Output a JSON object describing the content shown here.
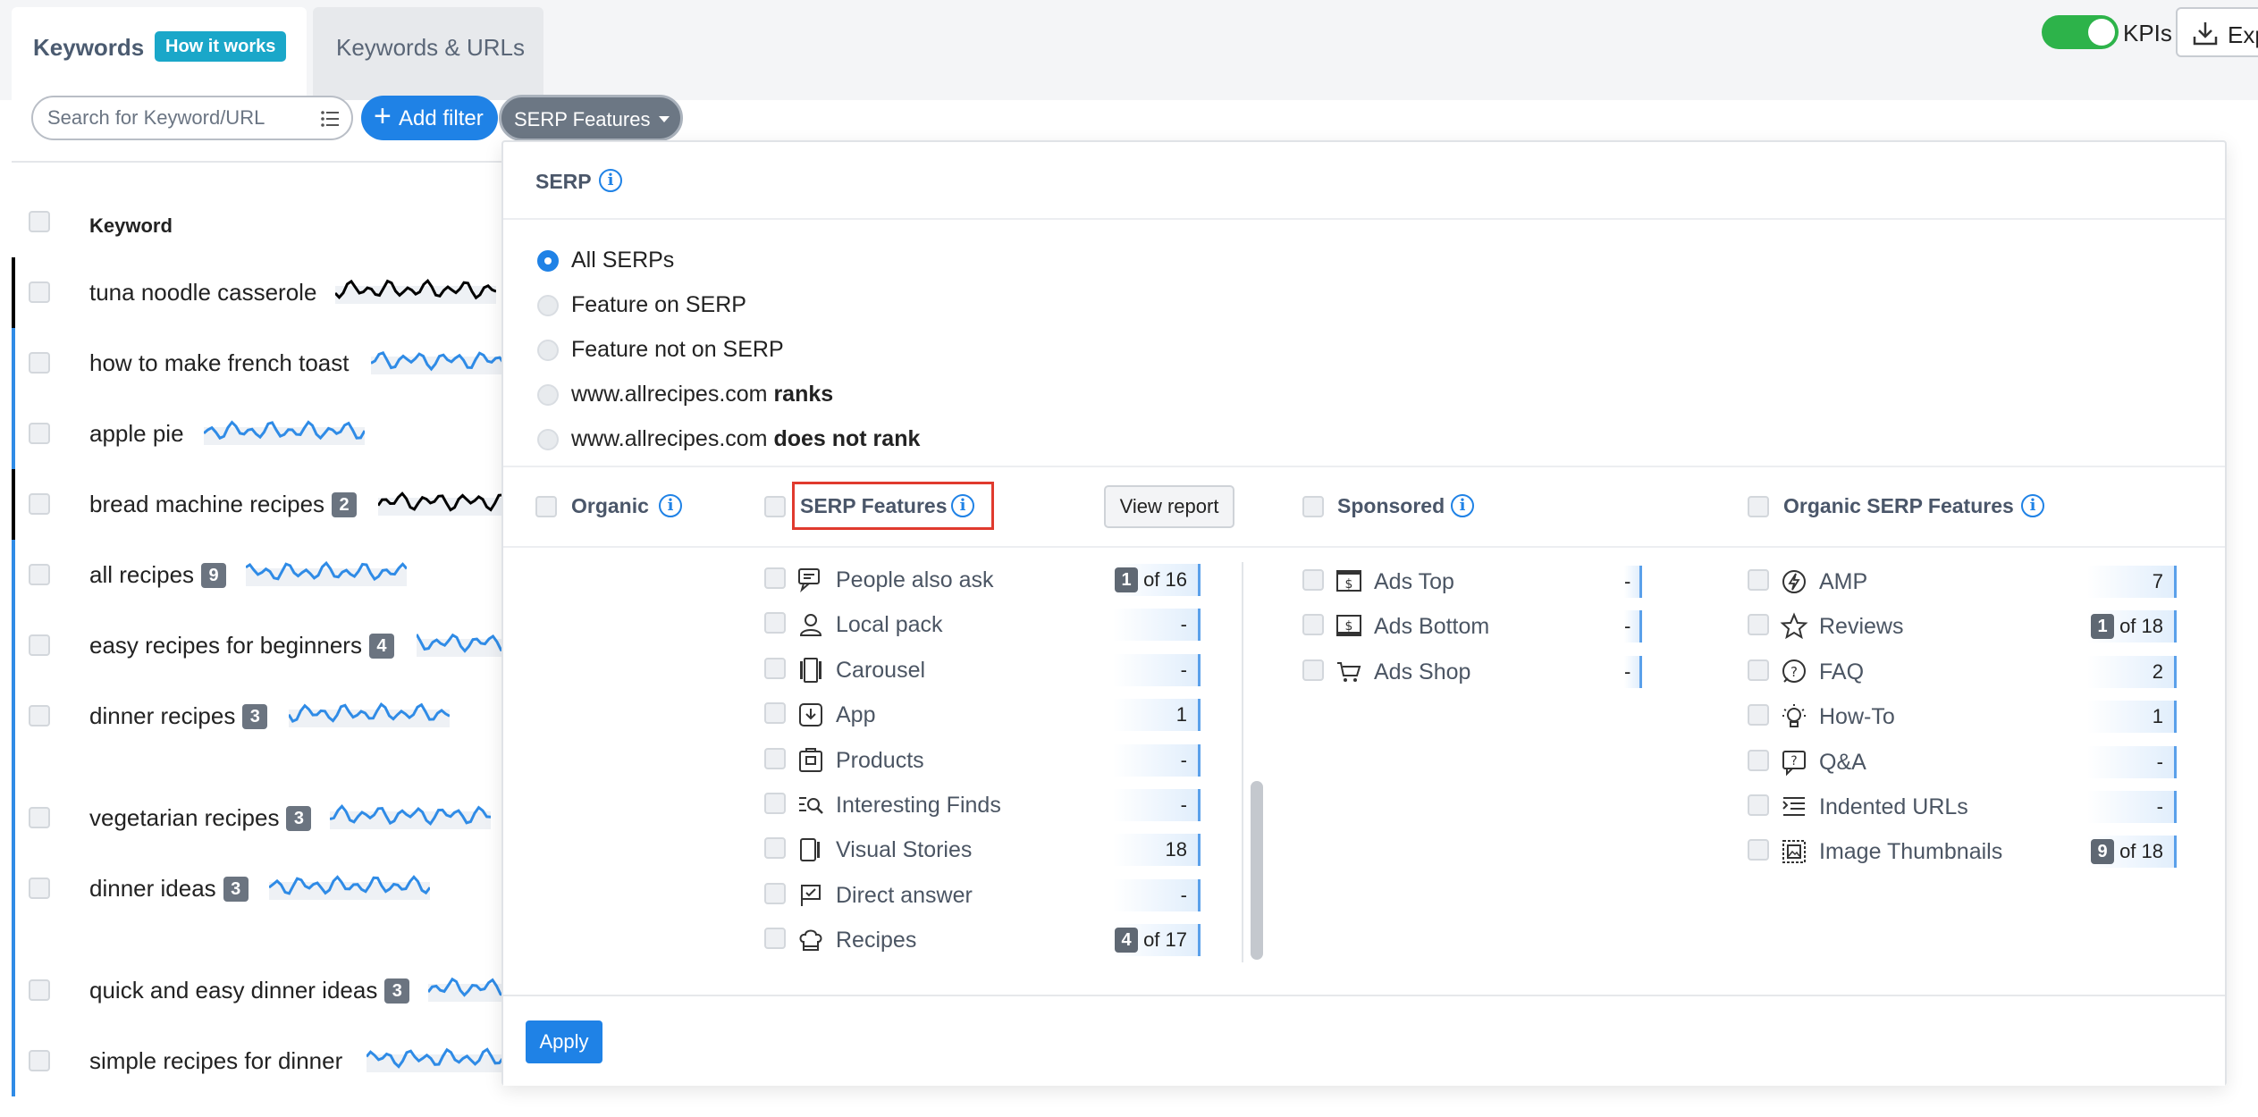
{
  "tabs": {
    "keywords_label": "Keywords",
    "how_it_works": "How it works",
    "keywords_urls_label": "Keywords & URLs"
  },
  "header": {
    "kpis_label": "KPIs",
    "export_label": "Exp",
    "kpis_on": true
  },
  "toolbar": {
    "search_placeholder": "Search for Keyword/URL",
    "add_filter_label": "Add filter",
    "serp_features_label": "SERP Features"
  },
  "table": {
    "keyword_header": "Keyword",
    "rows": [
      {
        "keyword": "tuna noodle casserole",
        "count": "",
        "color": "#000000"
      },
      {
        "keyword": "how to make french toast",
        "count": "",
        "color": "#2f8be6"
      },
      {
        "keyword": "apple pie",
        "count": "",
        "color": "#2f8be6"
      },
      {
        "keyword": "bread machine recipes",
        "count": "2",
        "color": "#000000"
      },
      {
        "keyword": "all recipes",
        "count": "9",
        "color": "#2f8be6"
      },
      {
        "keyword": "easy recipes for beginners",
        "count": "4",
        "color": "#2f8be6"
      },
      {
        "keyword": "dinner recipes",
        "count": "3",
        "color": "#2f8be6"
      },
      {
        "keyword": "vegetarian recipes",
        "count": "3",
        "color": "#2f8be6"
      },
      {
        "keyword": "dinner ideas",
        "count": "3",
        "color": "#2f8be6"
      },
      {
        "keyword": "quick and easy dinner ideas",
        "count": "3",
        "color": "#2f8be6"
      },
      {
        "keyword": "simple recipes for dinner",
        "count": "",
        "color": "#2f8be6"
      }
    ]
  },
  "popup": {
    "serp_title": "SERP",
    "radios": [
      {
        "label": "All SERPs",
        "bold": "",
        "selected": true
      },
      {
        "label": "Feature on SERP",
        "bold": "",
        "selected": false
      },
      {
        "label": "Feature not on SERP",
        "bold": "",
        "selected": false
      },
      {
        "label": "www.allrecipes.com ",
        "bold": "ranks",
        "selected": false
      },
      {
        "label": "www.allrecipes.com ",
        "bold": "does not rank",
        "selected": false
      }
    ],
    "organic_title": "Organic",
    "serp_features_title": "SERP Features",
    "view_report_label": "View report",
    "sponsored_title": "Sponsored",
    "organic_serp_features_title": "Organic SERP Features",
    "serp_features": [
      {
        "label": "People also ask",
        "icon": "people-also-ask-icon",
        "badge": "1",
        "value": "of 16"
      },
      {
        "label": "Local pack",
        "icon": "local-pack-icon",
        "badge": "",
        "value": "-"
      },
      {
        "label": "Carousel",
        "icon": "carousel-icon",
        "badge": "",
        "value": "-"
      },
      {
        "label": "App",
        "icon": "app-icon",
        "badge": "",
        "value": "1"
      },
      {
        "label": "Products",
        "icon": "products-icon",
        "badge": "",
        "value": "-"
      },
      {
        "label": "Interesting Finds",
        "icon": "interesting-finds-icon",
        "badge": "",
        "value": "-"
      },
      {
        "label": "Visual Stories",
        "icon": "visual-stories-icon",
        "badge": "",
        "value": "18"
      },
      {
        "label": "Direct answer",
        "icon": "direct-answer-icon",
        "badge": "",
        "value": "-"
      },
      {
        "label": "Recipes",
        "icon": "recipes-icon",
        "badge": "4",
        "value": "of 17"
      }
    ],
    "sponsored": [
      {
        "label": "Ads Top",
        "icon": "ads-top-icon",
        "value": "-"
      },
      {
        "label": "Ads Bottom",
        "icon": "ads-bottom-icon",
        "value": "-"
      },
      {
        "label": "Ads Shop",
        "icon": "ads-shop-icon",
        "value": "-"
      }
    ],
    "organic_features": [
      {
        "label": "AMP",
        "icon": "amp-icon",
        "badge": "",
        "value": "7"
      },
      {
        "label": "Reviews",
        "icon": "reviews-star-icon",
        "badge": "1",
        "value": "of 18"
      },
      {
        "label": "FAQ",
        "icon": "faq-icon",
        "badge": "",
        "value": "2"
      },
      {
        "label": "How-To",
        "icon": "how-to-icon",
        "badge": "",
        "value": "1"
      },
      {
        "label": "Q&A",
        "icon": "qa-icon",
        "badge": "",
        "value": "-"
      },
      {
        "label": "Indented URLs",
        "icon": "indented-urls-icon",
        "badge": "",
        "value": "-"
      },
      {
        "label": "Image Thumbnails",
        "icon": "image-thumbnails-icon",
        "badge": "9",
        "value": "of 18"
      }
    ],
    "apply_label": "Apply"
  }
}
